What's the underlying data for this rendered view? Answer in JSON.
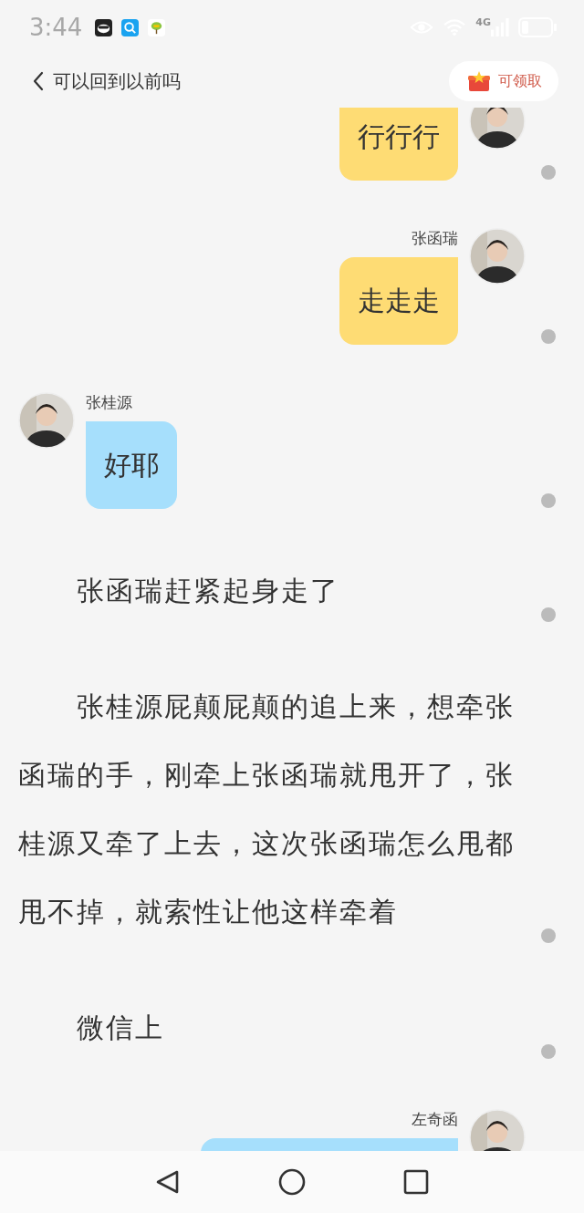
{
  "status_bar": {
    "time": "3:44",
    "network": "4G"
  },
  "header": {
    "title": "可以回到以前吗",
    "reward_button": "可领取"
  },
  "items": [
    {
      "kind": "sent",
      "color": "#fedc74",
      "text": "行行行"
    },
    {
      "kind": "sent",
      "color": "#fedc74",
      "name": "张函瑞",
      "text": "走走走"
    },
    {
      "kind": "received",
      "color": "#a6dffc",
      "name": "张桂源",
      "text": "好耶"
    },
    {
      "kind": "narration",
      "text": "张函瑞赶紧起身走了"
    },
    {
      "kind": "narration",
      "text": "张桂源屁颠屁颠的追上来，想牵张函瑞的手，刚牵上张函瑞就甩开了，张桂源又牵了上去，这次张函瑞怎么甩都甩不掉，就索性让他这样牵着"
    },
    {
      "kind": "narration",
      "text": "微信上"
    },
    {
      "kind": "sent",
      "color": "#a6dffc",
      "name": "左奇函"
    }
  ]
}
